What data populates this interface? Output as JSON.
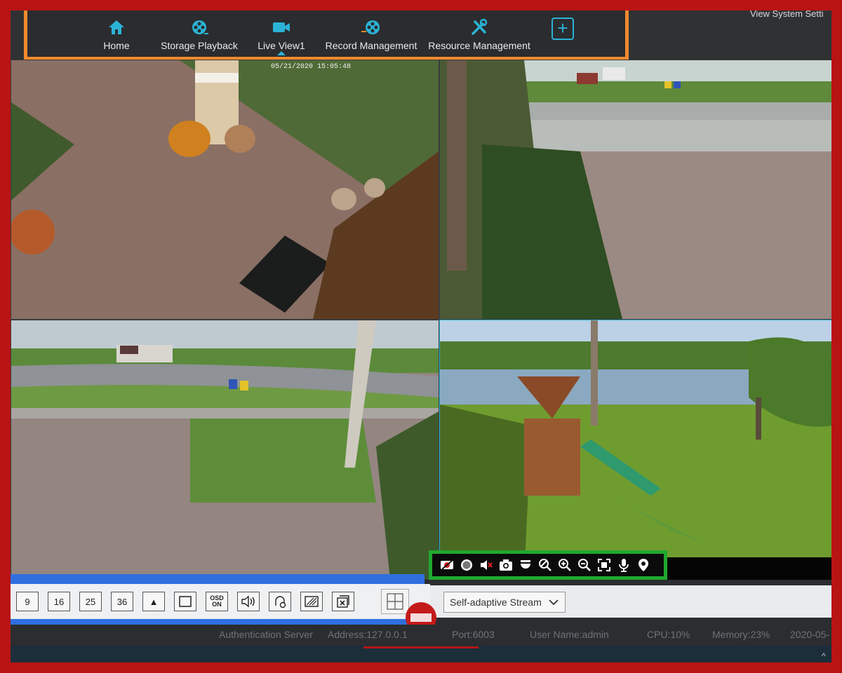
{
  "nav": {
    "items": [
      {
        "label": "Home",
        "icon": "home-icon"
      },
      {
        "label": "Storage Playback",
        "icon": "film-reel-icon"
      },
      {
        "label": "Live View1",
        "icon": "video-camera-icon",
        "active": true
      },
      {
        "label": "Record Management",
        "icon": "film-reel-icon"
      },
      {
        "label": "Resource Management",
        "icon": "tools-icon"
      }
    ],
    "add_label": "+"
  },
  "header": {
    "system_settings": "View System Setti"
  },
  "video": {
    "osd_timestamp": "05/21/2020 15:05:48"
  },
  "layout_buttons": [
    "9",
    "16",
    "25",
    "36"
  ],
  "layout_icons": [
    "sequence-icon",
    "fullscreen-icon",
    "osd-toggle-icon",
    "audio-icon",
    "lock-screen-icon",
    "pattern-icon",
    "close-all-icon"
  ],
  "osd_button": {
    "line1": "OSD",
    "line2": "ON"
  },
  "camera_toolbar": [
    "record-switch-icon",
    "record-icon",
    "mute-icon",
    "snapshot-icon",
    "ptz-icon",
    "zoom-disable-icon",
    "zoom-in-icon",
    "zoom-out-icon",
    "fit-screen-icon",
    "microphone-icon",
    "location-icon"
  ],
  "stream": {
    "selected": "Self-adaptive Stream"
  },
  "status": {
    "server": "Authentication Server",
    "address": "Address:127.0.0.1",
    "port": "Port:6003",
    "user": "User Name:admin",
    "cpu": "CPU:10%",
    "memory": "Memory:23%",
    "date": "2020-05-"
  },
  "colors": {
    "accent": "#2bb3d6",
    "nav_frame": "#f28a2c",
    "toolbar_frame": "#21a82f",
    "layout_frame": "#2f6fe0",
    "border": "#b81414"
  }
}
